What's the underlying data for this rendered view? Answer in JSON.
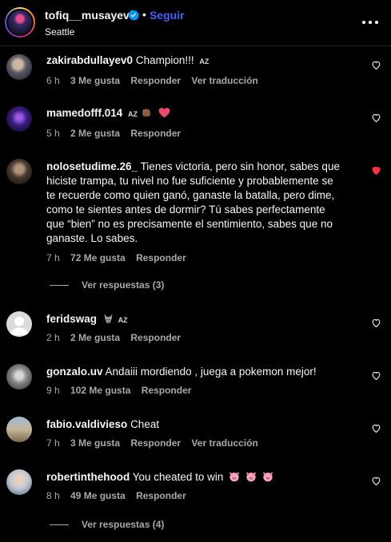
{
  "header": {
    "username": "tofiq__musayev",
    "separator": "•",
    "follow_label": "Seguir",
    "location": "Seattle"
  },
  "comments": [
    {
      "username": "zakirabdullayev0",
      "text": "Champion!!!",
      "badge": "AZ",
      "time": "6 h",
      "likes": "3 Me gusta",
      "reply": "Responder",
      "translate": "Ver traducción",
      "liked": false
    },
    {
      "username": "mamedofff.014",
      "text": "",
      "badge": "AZ",
      "emojis": [
        "fist-emoji",
        "heart-emoji"
      ],
      "time": "5 h",
      "likes": "2 Me gusta",
      "reply": "Responder",
      "liked": false
    },
    {
      "username": "nolosetudime.26_",
      "text": "Tienes victoria, pero sin honor, sabes que hiciste trampa, tu nivel no fue suficiente y probablemente se te recuerde como quien ganó, ganaste la batalla, pero dime, como te sientes antes de dormir? Tú sabes perfectamente que “bien” no es precisamente el sentimiento, sabes que no ganaste. Lo sabes.",
      "time": "7 h",
      "likes": "72 Me gusta",
      "reply": "Responder",
      "view_replies": "Ver respuestas (3)",
      "liked": true
    },
    {
      "username": "feridswag",
      "text": "",
      "badge": "AZ",
      "emojis": [
        "wolf-emoji"
      ],
      "time": "2 h",
      "likes": "2 Me gusta",
      "reply": "Responder",
      "liked": false
    },
    {
      "username": "gonzalo.uv",
      "text": "Andaiii mordiendo , juega a pokemon mejor!",
      "time": "9 h",
      "likes": "102 Me gusta",
      "reply": "Responder",
      "liked": false
    },
    {
      "username": "fabio.valdivieso",
      "text": "Cheat",
      "time": "7 h",
      "likes": "3 Me gusta",
      "reply": "Responder",
      "translate": "Ver traducción",
      "liked": false
    },
    {
      "username": "robertinthehood",
      "text": "You cheated to win",
      "emojis": [
        "pig-emoji",
        "pig-emoji",
        "pig-emoji"
      ],
      "time": "8 h",
      "likes": "49 Me gusta",
      "reply": "Responder",
      "view_replies": "Ver respuestas (4)",
      "liked": false
    }
  ],
  "colors": {
    "background": "#000000",
    "text": "#f5f5f5",
    "secondary_text": "#a8a8a8",
    "follow_blue": "#4a5df9",
    "verified_blue": "#0095f6",
    "liked_red": "#ff3040"
  }
}
